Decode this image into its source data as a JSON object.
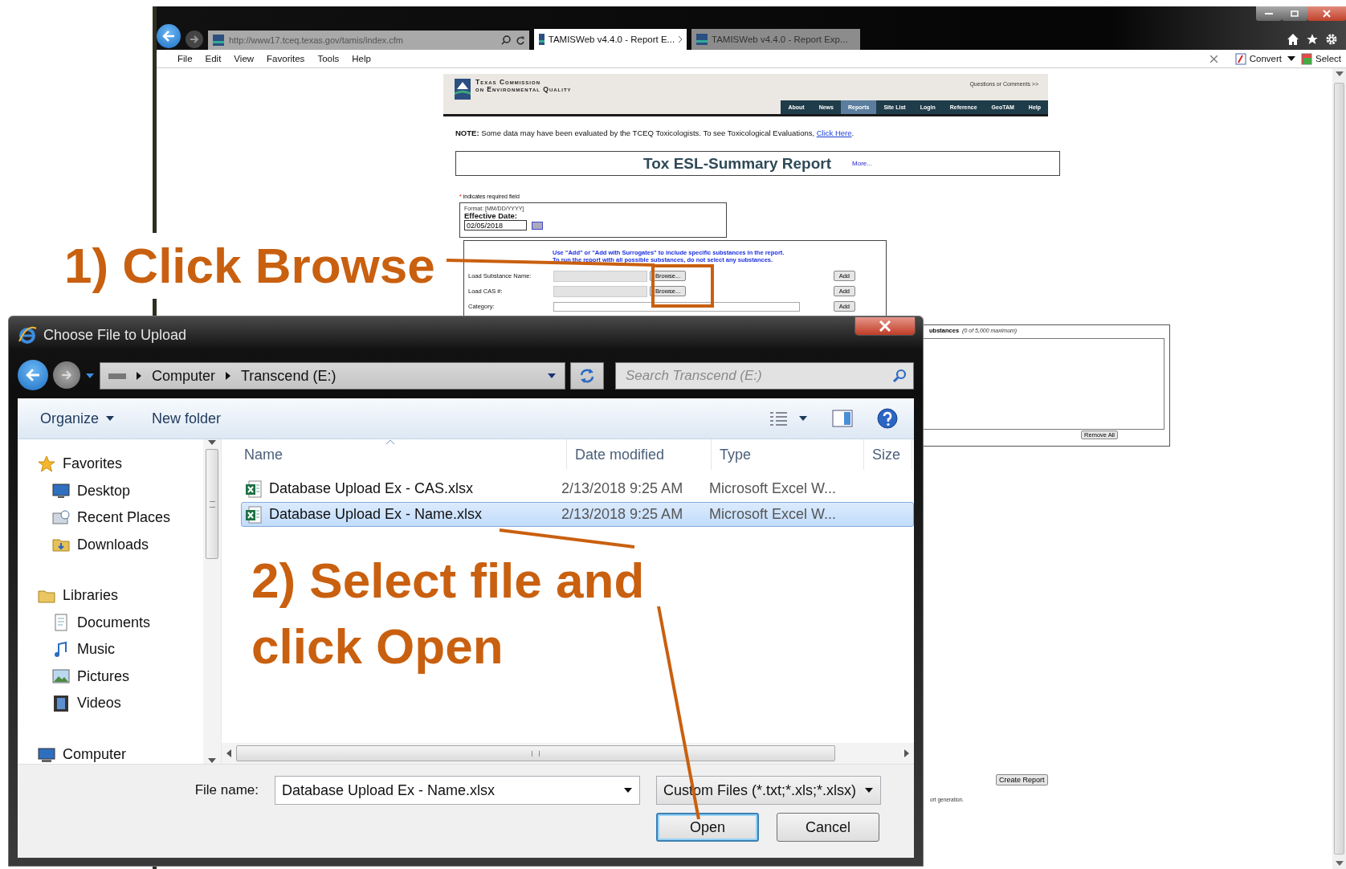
{
  "browser": {
    "address": "http://www17.tceq.texas.gov/tamis/index.cfm",
    "tabs": [
      {
        "label": "TAMISWeb v4.4.0 - Report E...",
        "selected": true
      },
      {
        "label": "TAMISWeb v4.4.0 - Report Exp...",
        "selected": false
      }
    ],
    "menu": [
      "File",
      "Edit",
      "View",
      "Favorites",
      "Tools",
      "Help"
    ],
    "toolbar": {
      "convert": "Convert",
      "select": "Select"
    }
  },
  "page": {
    "agency": [
      "Texas Commission",
      "on Environmental Quality"
    ],
    "questions": "Questions or Comments >>",
    "nav": [
      {
        "label": "About",
        "selected": false
      },
      {
        "label": "News",
        "selected": false
      },
      {
        "label": "Reports",
        "selected": true
      },
      {
        "label": "Site List",
        "selected": false
      },
      {
        "label": "Login",
        "selected": false
      },
      {
        "label": "Reference",
        "selected": false
      },
      {
        "label": "GeoTAM",
        "selected": false
      },
      {
        "label": "Help",
        "selected": false
      }
    ],
    "note": {
      "text": "**NOTE:** Some data may have been evaluated by the TCEQ Toxicologists. To see Toxicological Evaluations, ",
      "link": "Click Here",
      "end": "."
    },
    "report_title": "Tox ESL-Summary Report",
    "more_link": "More...",
    "required_mark": "*",
    "required_note": "indicates required field",
    "date": {
      "format": "Format: [MM/DD/YYYY]",
      "label": "Effective Date:",
      "value": "02/05/2018"
    },
    "instructions": [
      "Use \"Add\" or \"Add with Surrogates\" to include specific substances in the report.",
      "To run the report with all possible substances, do not select any substances."
    ],
    "loaders": [
      {
        "kind": "file",
        "label": "Load Substance Name:",
        "browse": "Browse...",
        "add": "Add"
      },
      {
        "kind": "file",
        "label": "Load CAS #:",
        "browse": "Browse...",
        "add": "Add"
      },
      {
        "kind": "select",
        "label": "Category:",
        "add": "Add"
      }
    ],
    "substances": {
      "title": "ubstances",
      "count": "(0 of 5,000 maximum)",
      "remove_all": "Remove All"
    },
    "create_report": "Create Report",
    "footnote": "ort generation."
  },
  "dialog": {
    "title": "Choose File to Upload",
    "path": [
      "Computer",
      "Transcend (E:)"
    ],
    "search": {
      "placeholder": "Search Transcend (E:)"
    },
    "toolbar": [
      "Organize",
      "New folder"
    ],
    "tree": [
      {
        "label": "Favorites",
        "kind": "favorites",
        "children": [
          {
            "label": "Desktop",
            "kind": "desktop"
          },
          {
            "label": "Recent Places",
            "kind": "recent"
          },
          {
            "label": "Downloads",
            "kind": "downloads"
          }
        ]
      },
      {
        "label": "Libraries",
        "kind": "libraries",
        "children": [
          {
            "label": "Documents",
            "kind": "documents"
          },
          {
            "label": "Music",
            "kind": "music"
          },
          {
            "label": "Pictures",
            "kind": "pictures"
          },
          {
            "label": "Videos",
            "kind": "videos"
          }
        ]
      },
      {
        "label": "Computer",
        "kind": "computer"
      }
    ],
    "columns": [
      "Name",
      "Date modified",
      "Type",
      "Size"
    ],
    "files": [
      {
        "name": "Database Upload Ex - CAS.xlsx",
        "date": "2/13/2018 9:25 AM",
        "type": "Microsoft Excel W...",
        "selected": false
      },
      {
        "name": "Database Upload Ex - Name.xlsx",
        "date": "2/13/2018 9:25 AM",
        "type": "Microsoft Excel W...",
        "selected": true
      }
    ],
    "file_name_label": "File name:",
    "file_name": "Database Upload Ex - Name.xlsx",
    "filter": "Custom Files (*.txt;*.xls;*.xlsx)",
    "buttons": [
      {
        "label": "Open",
        "default": true
      },
      {
        "label": "Cancel",
        "default": false
      }
    ]
  },
  "callouts": [
    "1) Click Browse",
    "2) Select file and click Open"
  ]
}
